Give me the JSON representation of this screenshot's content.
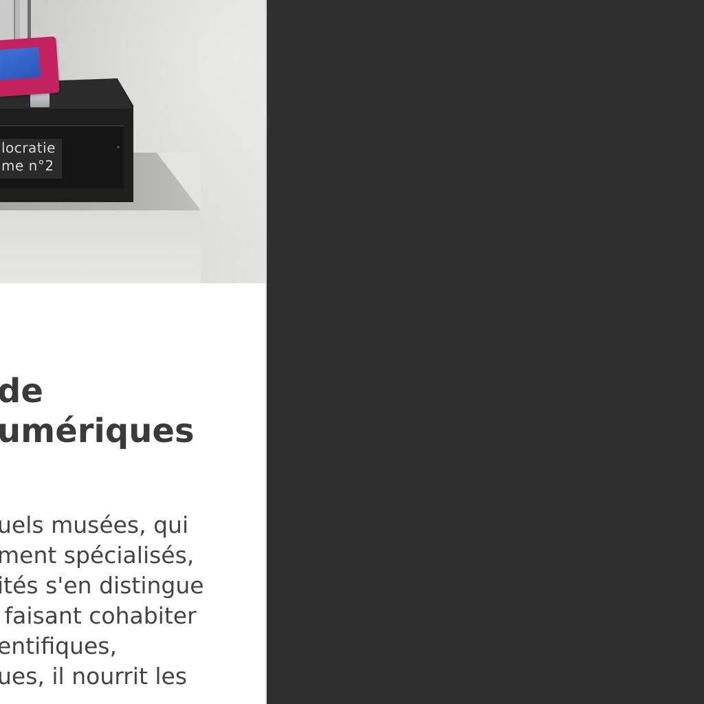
{
  "photo": {
    "label_text": "locratie\nme n°2"
  },
  "article": {
    "title": "de\numériques",
    "body": "uels musées, qui\nment spécialisés,\nités s'en distingue\n faisant cohabiter\nentifiques,\nues, il nourrit les"
  },
  "colors": {
    "panel_background": "#ffffff",
    "app_background": "#2f2f2f",
    "title_text": "#3b3b3b",
    "body_text": "#444444",
    "tablet_frame": "#c4225f",
    "tablet_screen": "#3e72d8"
  }
}
